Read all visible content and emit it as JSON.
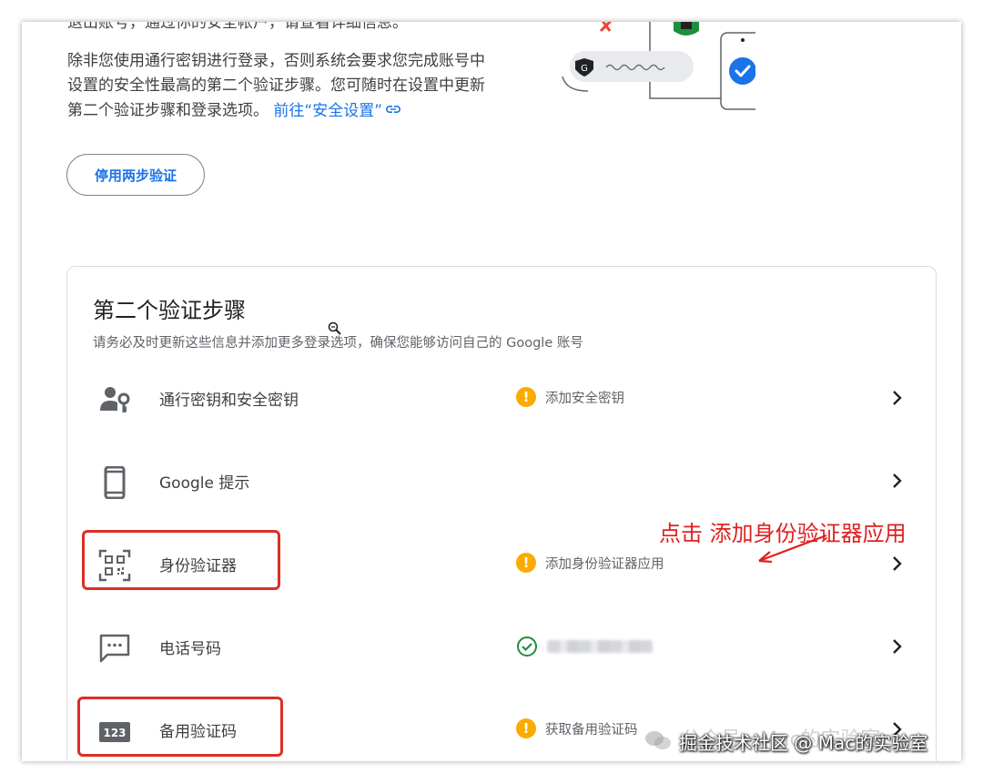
{
  "intro": {
    "cut_line": "退出账号，通过你的安全帐户，请查看详细信息。",
    "text": "除非您使用通行密钥进行登录，否则系统会要求您完成账号中设置的安全性最高的第二个验证步骤。您可随时在设置中更新第二个验证步骤和登录选项。",
    "link": "前往“安全设置”"
  },
  "disable_button": "停用两步验证",
  "card": {
    "title": "第二个验证步骤",
    "subtitle": "请务必及时更新这些信息并添加更多登录选项，确保您能够访问自己的 Google 账号",
    "rows": [
      {
        "label": "通行密钥和安全密钥",
        "status": "添加安全密钥",
        "status_type": "warning",
        "icon": "passkey-icon"
      },
      {
        "label": "Google 提示",
        "status": "",
        "status_type": "none",
        "icon": "phone-icon"
      },
      {
        "label": "身份验证器",
        "status": "添加身份验证器应用",
        "status_type": "warning",
        "icon": "qr-code-icon"
      },
      {
        "label": "电话号码",
        "status": "",
        "status_type": "ok-redacted",
        "icon": "sms-icon"
      },
      {
        "label": "备用验证码",
        "status": "获取备用验证码",
        "status_type": "warning",
        "icon": "backup-code-icon"
      }
    ]
  },
  "annotation": "点击 添加身份验证器应用",
  "watermark": {
    "ghost": "公众号 · Mac的实验室",
    "text": "掘金技术社区 @ Mac的实验室"
  },
  "illustration": {
    "bubble_letter": "G"
  },
  "colors": {
    "accent": "#1a73e8",
    "warning": "#f9ab00",
    "success": "#1e8e3e",
    "highlight": "#d93025"
  }
}
